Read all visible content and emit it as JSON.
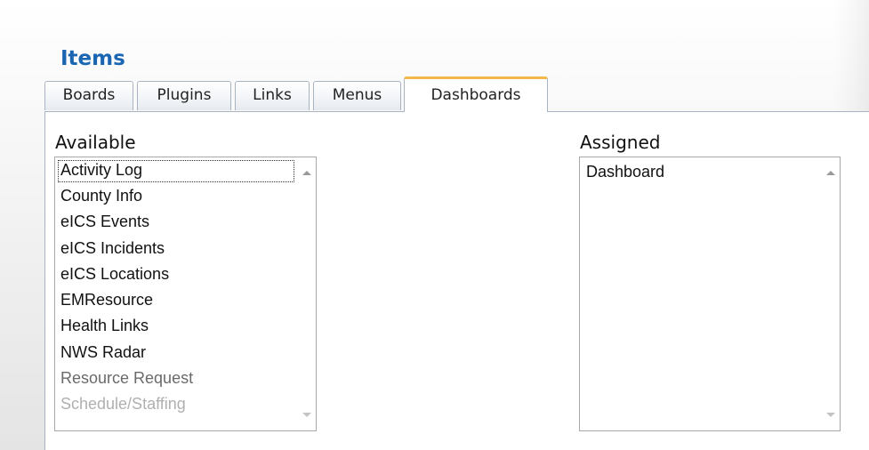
{
  "section": {
    "title": "Items"
  },
  "tabs": [
    {
      "label": "Boards",
      "active": false
    },
    {
      "label": "Plugins",
      "active": false
    },
    {
      "label": "Links",
      "active": false
    },
    {
      "label": "Menus",
      "active": false
    },
    {
      "label": "Dashboards",
      "active": true
    }
  ],
  "available": {
    "label": "Available",
    "items": [
      "Activity Log",
      "County Info",
      "eICS Events",
      "eICS Incidents",
      "eICS Locations",
      "EMResource",
      "Health Links",
      "NWS Radar",
      "Resource Request",
      "Schedule/Staffing"
    ],
    "focused_item": "Activity Log"
  },
  "assigned": {
    "label": "Assigned",
    "items": [
      "Dashboard"
    ]
  },
  "colors": {
    "title": "#1b66b2",
    "active_tab_accent": "#f2b84a",
    "border": "#a9b4c2"
  },
  "icons": {
    "scroll_up": "chevron-up-icon",
    "scroll_down": "chevron-down-icon"
  }
}
